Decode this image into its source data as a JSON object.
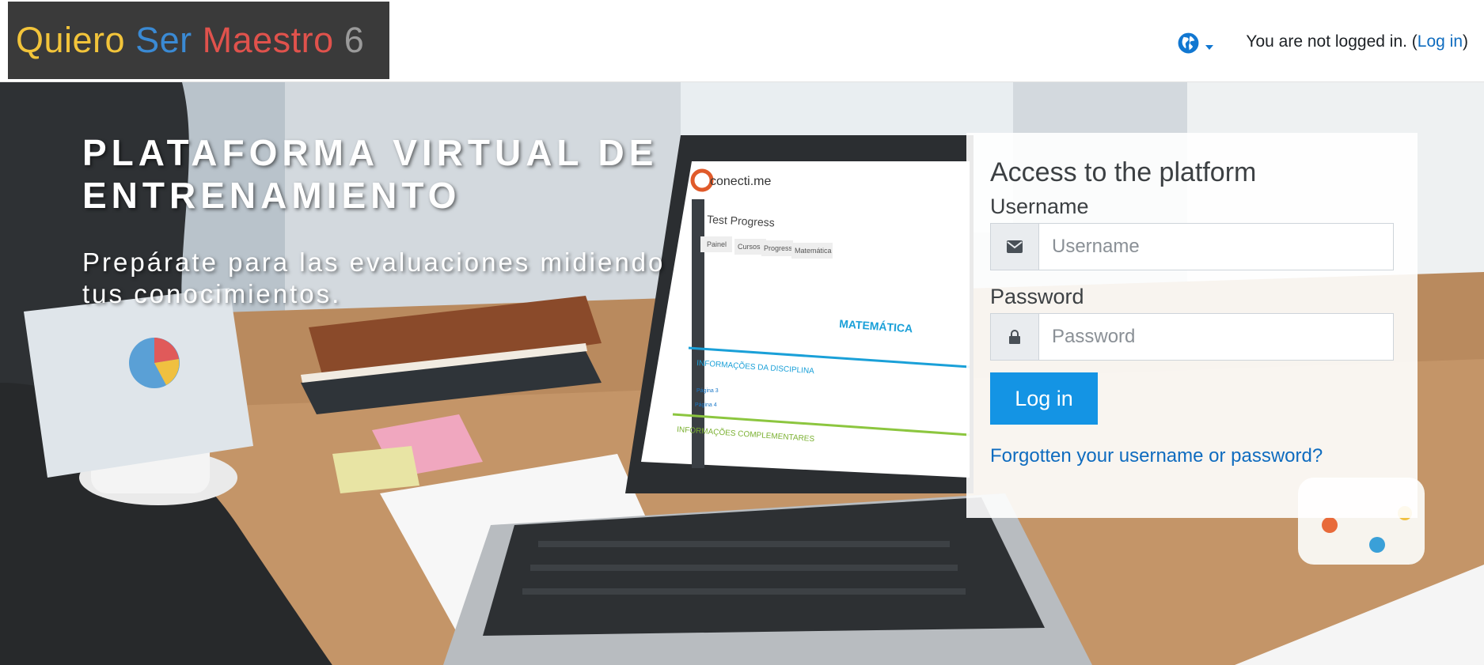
{
  "header": {
    "logo": {
      "word1": "Quiero",
      "word2": "Ser",
      "word3": "Maestro",
      "word4": "6",
      "colors": [
        "#f2c43a",
        "#3a8ad4",
        "#e0524c",
        "#9a9a9a"
      ]
    },
    "language_icon": "globe-icon",
    "login_status_prefix": "You are not logged in. (",
    "login_link": "Log in",
    "login_status_suffix": ")"
  },
  "hero": {
    "headline_line1": "PLATAFORMA VIRTUAL DE",
    "headline_line2": "ENTRENAMIENTO",
    "subheadline_line1": "Prepárate para las evaluaciones midiendo",
    "subheadline_line2": "tus conocimientos."
  },
  "screen_mockup": {
    "brand": "conecti.me",
    "title": "Test Progress",
    "tabs": [
      "Painel",
      "Cursos",
      "Progress",
      "Matemática"
    ],
    "section_title": "MATEMÁTICA",
    "section1": "INFORMAÇÕES DA DISCIPLINA",
    "link1": "Página 3",
    "link2": "Página 4",
    "section2": "INFORMAÇÕES COMPLEMENTARES"
  },
  "login_panel": {
    "title": "Access to the platform",
    "username_label": "Username",
    "username_placeholder": "Username",
    "username_icon": "envelope-icon",
    "password_label": "Password",
    "password_placeholder": "Password",
    "password_icon": "lock-icon",
    "submit_label": "Log in",
    "forgot_link": "Forgotten your username or password?"
  },
  "colors": {
    "accent": "#1494e4",
    "link": "#0f6cbf"
  }
}
